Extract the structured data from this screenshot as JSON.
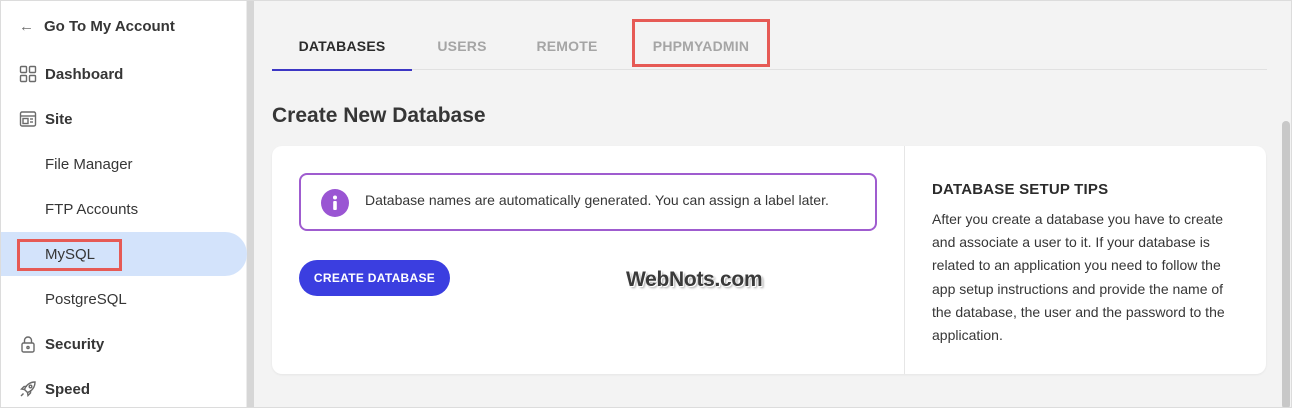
{
  "sidebar": {
    "back_label": "Go To My Account",
    "items": [
      {
        "label": "Dashboard",
        "icon": "grid-icon"
      },
      {
        "label": "Site",
        "icon": "site-icon"
      },
      {
        "label": "File Manager"
      },
      {
        "label": "FTP Accounts"
      },
      {
        "label": "MySQL",
        "active": true
      },
      {
        "label": "PostgreSQL"
      },
      {
        "label": "Security",
        "icon": "lock-icon"
      },
      {
        "label": "Speed",
        "icon": "rocket-icon"
      }
    ]
  },
  "tabs": [
    {
      "label": "DATABASES",
      "active": true
    },
    {
      "label": "USERS"
    },
    {
      "label": "REMOTE"
    },
    {
      "label": "PHPMYADMIN"
    }
  ],
  "page_title": "Create New Database",
  "notice": {
    "icon": "info-icon",
    "text": "Database names are automatically generated. You can assign a label later."
  },
  "create_button_label": "CREATE DATABASE",
  "watermark": "WebNots.com",
  "tips": {
    "title": "DATABASE SETUP TIPS",
    "body": "After you create a database you have to create and associate a user to it. If your database is related to an application you need to follow the app setup instructions and provide the name of the database, the user and the password to the application."
  },
  "colors": {
    "accent": "#3b3ee0",
    "active_nav_bg": "#d3e3fb",
    "notice_border": "#9f5ccf",
    "highlight_box": "#e65a55"
  }
}
